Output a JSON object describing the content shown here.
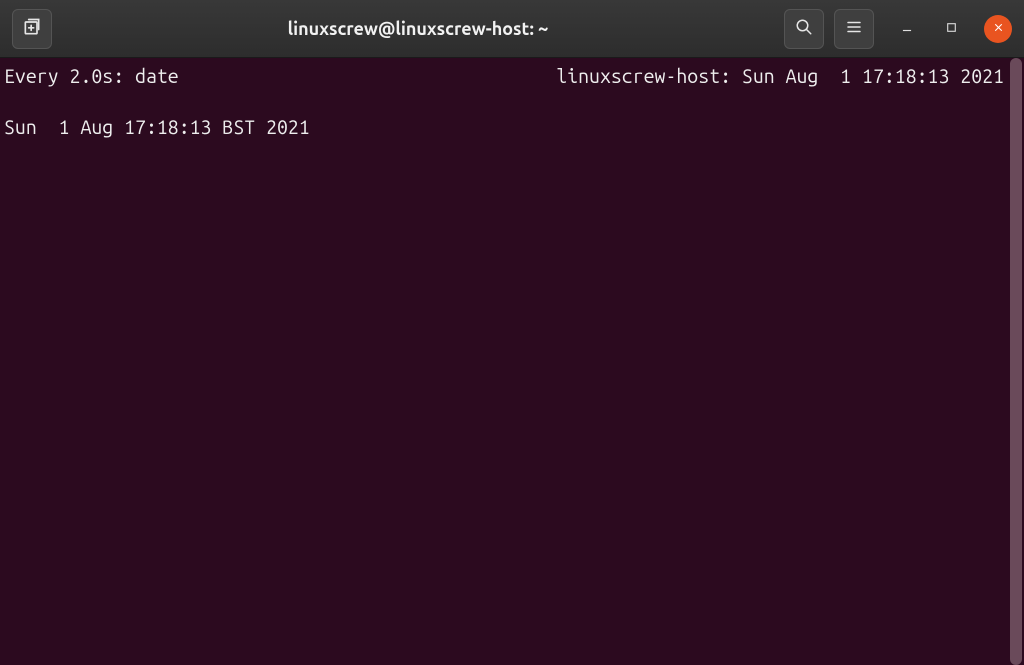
{
  "titlebar": {
    "title": "linuxscrew@linuxscrew-host: ~"
  },
  "terminal": {
    "watch_header_left": "Every 2.0s: date",
    "watch_header_right": "linuxscrew-host: Sun Aug  1 17:18:13 2021",
    "output": "Sun  1 Aug 17:18:13 BST 2021"
  },
  "icons": {
    "new_tab": "new-tab-icon",
    "search": "search-icon",
    "menu": "hamburger-menu-icon",
    "minimize": "minimize-icon",
    "maximize": "maximize-icon",
    "close": "close-icon"
  }
}
